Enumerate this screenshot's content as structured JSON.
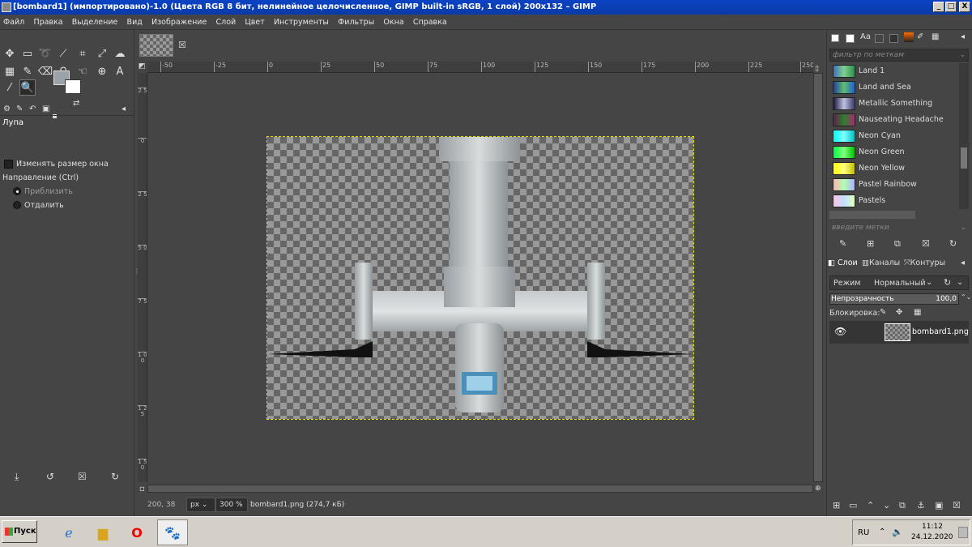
{
  "window": {
    "title": "[bombard1] (импортировано)-1.0 (Цвета RGB 8 бит, нелинейное целочисленное, GIMP built-in sRGB, 1 слой) 200x132 – GIMP",
    "minimize": "_",
    "maximize": "□",
    "close": "X"
  },
  "menu": [
    "Файл",
    "Правка",
    "Выделение",
    "Вид",
    "Изображение",
    "Слой",
    "Цвет",
    "Инструменты",
    "Фильтры",
    "Окна",
    "Справка"
  ],
  "tool_options": {
    "title": "Лупа",
    "resize_window": "Изменять размер окна",
    "direction_label": "Направление (Ctrl)",
    "zoom_in": "Приблизить",
    "zoom_out": "Отдалить"
  },
  "ruler": {
    "h_ticks": [
      "-50",
      "-25",
      "0",
      "25",
      "50",
      "75",
      "100",
      "125",
      "150",
      "175",
      "200",
      "225",
      "250"
    ],
    "v_ticks": [
      "2 5",
      "0",
      "2 5",
      "5 0",
      "7 5",
      "1 0 0",
      "1 2 5",
      "1 5 0"
    ]
  },
  "status": {
    "coords": "200, 38",
    "unit": "px",
    "zoom": "300 %",
    "file": "bombard1.png (274,7 кБ)"
  },
  "gradients": {
    "filter_placeholder": "фильтр по меткам",
    "tag_placeholder": "введите метки",
    "items": [
      {
        "label": "Land 1",
        "colors": [
          "#3f6fbf",
          "#7fd08f",
          "#2f8f4f"
        ]
      },
      {
        "label": "Land and Sea",
        "colors": [
          "#1f3f9f",
          "#5fbf6f",
          "#1f5fcf"
        ]
      },
      {
        "label": "Metallic Something",
        "colors": [
          "#1a1a3a",
          "#c0c0e0",
          "#3a3a6a"
        ]
      },
      {
        "label": "Nauseating Headache",
        "colors": [
          "#5f1f4f",
          "#2f7f2f",
          "#9f2f6f"
        ]
      },
      {
        "label": "Neon Cyan",
        "colors": [
          "#00ffff",
          "#80ffff",
          "#00c0c0"
        ]
      },
      {
        "label": "Neon Green",
        "colors": [
          "#00ff40",
          "#80ff80",
          "#00c000"
        ]
      },
      {
        "label": "Neon Yellow",
        "colors": [
          "#ffff00",
          "#ffff80",
          "#c0c000"
        ]
      },
      {
        "label": "Pastel Rainbow",
        "colors": [
          "#ffb0b0",
          "#b0ffb0",
          "#b0b0ff"
        ]
      },
      {
        "label": "Pastels",
        "colors": [
          "#ffc0e0",
          "#c0e0ff",
          "#e0ffc0"
        ]
      }
    ]
  },
  "layers": {
    "tabs": [
      "Слои",
      "Каналы",
      "Контуры"
    ],
    "mode_label": "Режим",
    "mode_value": "Нормальный",
    "opacity_label": "Непрозрачность",
    "opacity_value": "100,0",
    "lock_label": "Блокировка:",
    "layer_name": "bombard1.png"
  },
  "taskbar": {
    "start": "Пуск",
    "lang": "RU",
    "time": "11:12",
    "date": "24.12.2020"
  }
}
